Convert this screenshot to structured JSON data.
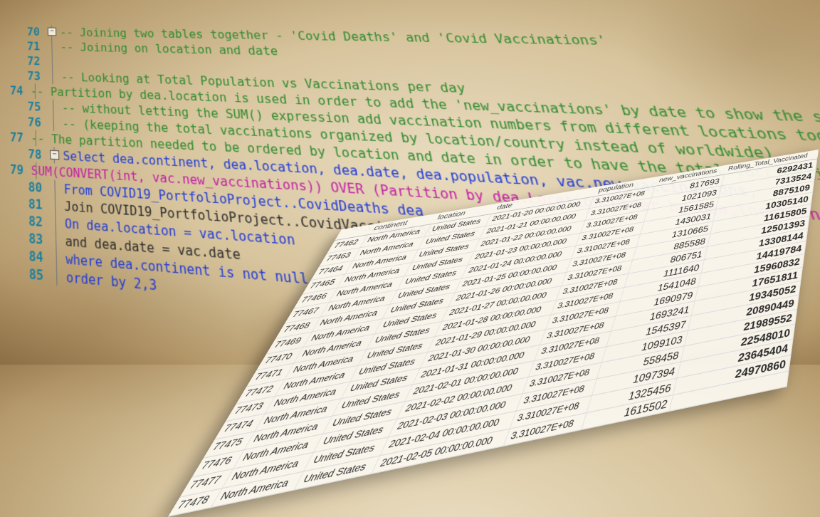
{
  "code": {
    "lines": [
      {
        "num": "70",
        "text": "-- Joining two tables together - 'Covid Deaths' and 'Covid Vaccinations'"
      },
      {
        "num": "71",
        "text": "-- Joining on location and date"
      },
      {
        "num": "72",
        "text": ""
      },
      {
        "num": "73",
        "text": "-- Looking at Total Population vs Vaccinations per day"
      },
      {
        "num": "74",
        "text": "-- Partition by dea.location is used in order to add the 'new_vaccinations' by date to show the sum of total vaccinations"
      },
      {
        "num": "75",
        "text": "-- without letting the SUM() expression add vaccination numbers from different locations together"
      },
      {
        "num": "76",
        "text": "-- (keeping the total vaccinations organized by location/country instead of worldwide)"
      },
      {
        "num": "77",
        "text": "-- The partition needed to be ordered by location and date in order to have the total vaccinations show per day rather than grand total"
      },
      {
        "num": "78",
        "text": "Select dea.continent, dea.location, dea.date, dea.population, vac.new_vaccinations,"
      },
      {
        "num": "79",
        "text": "SUM(CONVERT(int, vac.new_vaccinations)) OVER (Partition by dea.Location Order by dea.location, dea.date) as Rolling_Total_Vaccinated"
      },
      {
        "num": "80",
        "text": "From COVID19_PortfolioProject..CovidDeaths dea"
      },
      {
        "num": "81",
        "text": "Join COVID19_PortfolioProject..CovidVaccinations vac"
      },
      {
        "num": "82",
        "text": "On dea.location = vac.location"
      },
      {
        "num": "83",
        "text": "and dea.date = vac.date"
      },
      {
        "num": "84",
        "text": "where dea.continent is not null"
      },
      {
        "num": "85",
        "text": "order by 2,3"
      }
    ]
  },
  "results": {
    "columns": [
      "",
      "continent",
      "location",
      "date",
      "population",
      "new_vaccinations",
      "Rolling_Total_Vaccinated"
    ],
    "rows": [
      [
        "77462",
        "North America",
        "United States",
        "2021-01-20 00:00:00.000",
        "3.310027E+08",
        "817693",
        "6292431"
      ],
      [
        "77463",
        "North America",
        "United States",
        "2021-01-21 00:00:00.000",
        "3.310027E+08",
        "1021093",
        "7313524"
      ],
      [
        "77464",
        "North America",
        "United States",
        "2021-01-22 00:00:00.000",
        "3.310027E+08",
        "1561585",
        "8875109"
      ],
      [
        "77465",
        "North America",
        "United States",
        "2021-01-23 00:00:00.000",
        "3.310027E+08",
        "1430031",
        "10305140"
      ],
      [
        "77466",
        "North America",
        "United States",
        "2021-01-24 00:00:00.000",
        "3.310027E+08",
        "1310665",
        "11615805"
      ],
      [
        "77467",
        "North America",
        "United States",
        "2021-01-25 00:00:00.000",
        "3.310027E+08",
        "885588",
        "12501393"
      ],
      [
        "77468",
        "North America",
        "United States",
        "2021-01-26 00:00:00.000",
        "3.310027E+08",
        "806751",
        "13308144"
      ],
      [
        "77469",
        "North America",
        "United States",
        "2021-01-27 00:00:00.000",
        "3.310027E+08",
        "1111640",
        "14419784"
      ],
      [
        "77470",
        "North America",
        "United States",
        "2021-01-28 00:00:00.000",
        "3.310027E+08",
        "1541048",
        "15960832"
      ],
      [
        "77471",
        "North America",
        "United States",
        "2021-01-29 00:00:00.000",
        "3.310027E+08",
        "1690979",
        "17651811"
      ],
      [
        "77472",
        "North America",
        "United States",
        "2021-01-30 00:00:00.000",
        "3.310027E+08",
        "1693241",
        "19345052"
      ],
      [
        "77473",
        "North America",
        "United States",
        "2021-01-31 00:00:00.000",
        "3.310027E+08",
        "1545397",
        "20890449"
      ],
      [
        "77474",
        "North America",
        "United States",
        "2021-02-01 00:00:00.000",
        "3.310027E+08",
        "1099103",
        "21989552"
      ],
      [
        "77475",
        "North America",
        "United States",
        "2021-02-02 00:00:00.000",
        "3.310027E+08",
        "558458",
        "22548010"
      ],
      [
        "77476",
        "North America",
        "United States",
        "2021-02-03 00:00:00.000",
        "3.310027E+08",
        "1097394",
        "23645404"
      ],
      [
        "77477",
        "North America",
        "United States",
        "2021-02-04 00:00:00.000",
        "3.310027E+08",
        "1325456",
        "24970860"
      ],
      [
        "77478",
        "North America",
        "United States",
        "2021-02-05 00:00:00.000",
        "3.310027E+08",
        "1615502",
        ""
      ]
    ]
  }
}
